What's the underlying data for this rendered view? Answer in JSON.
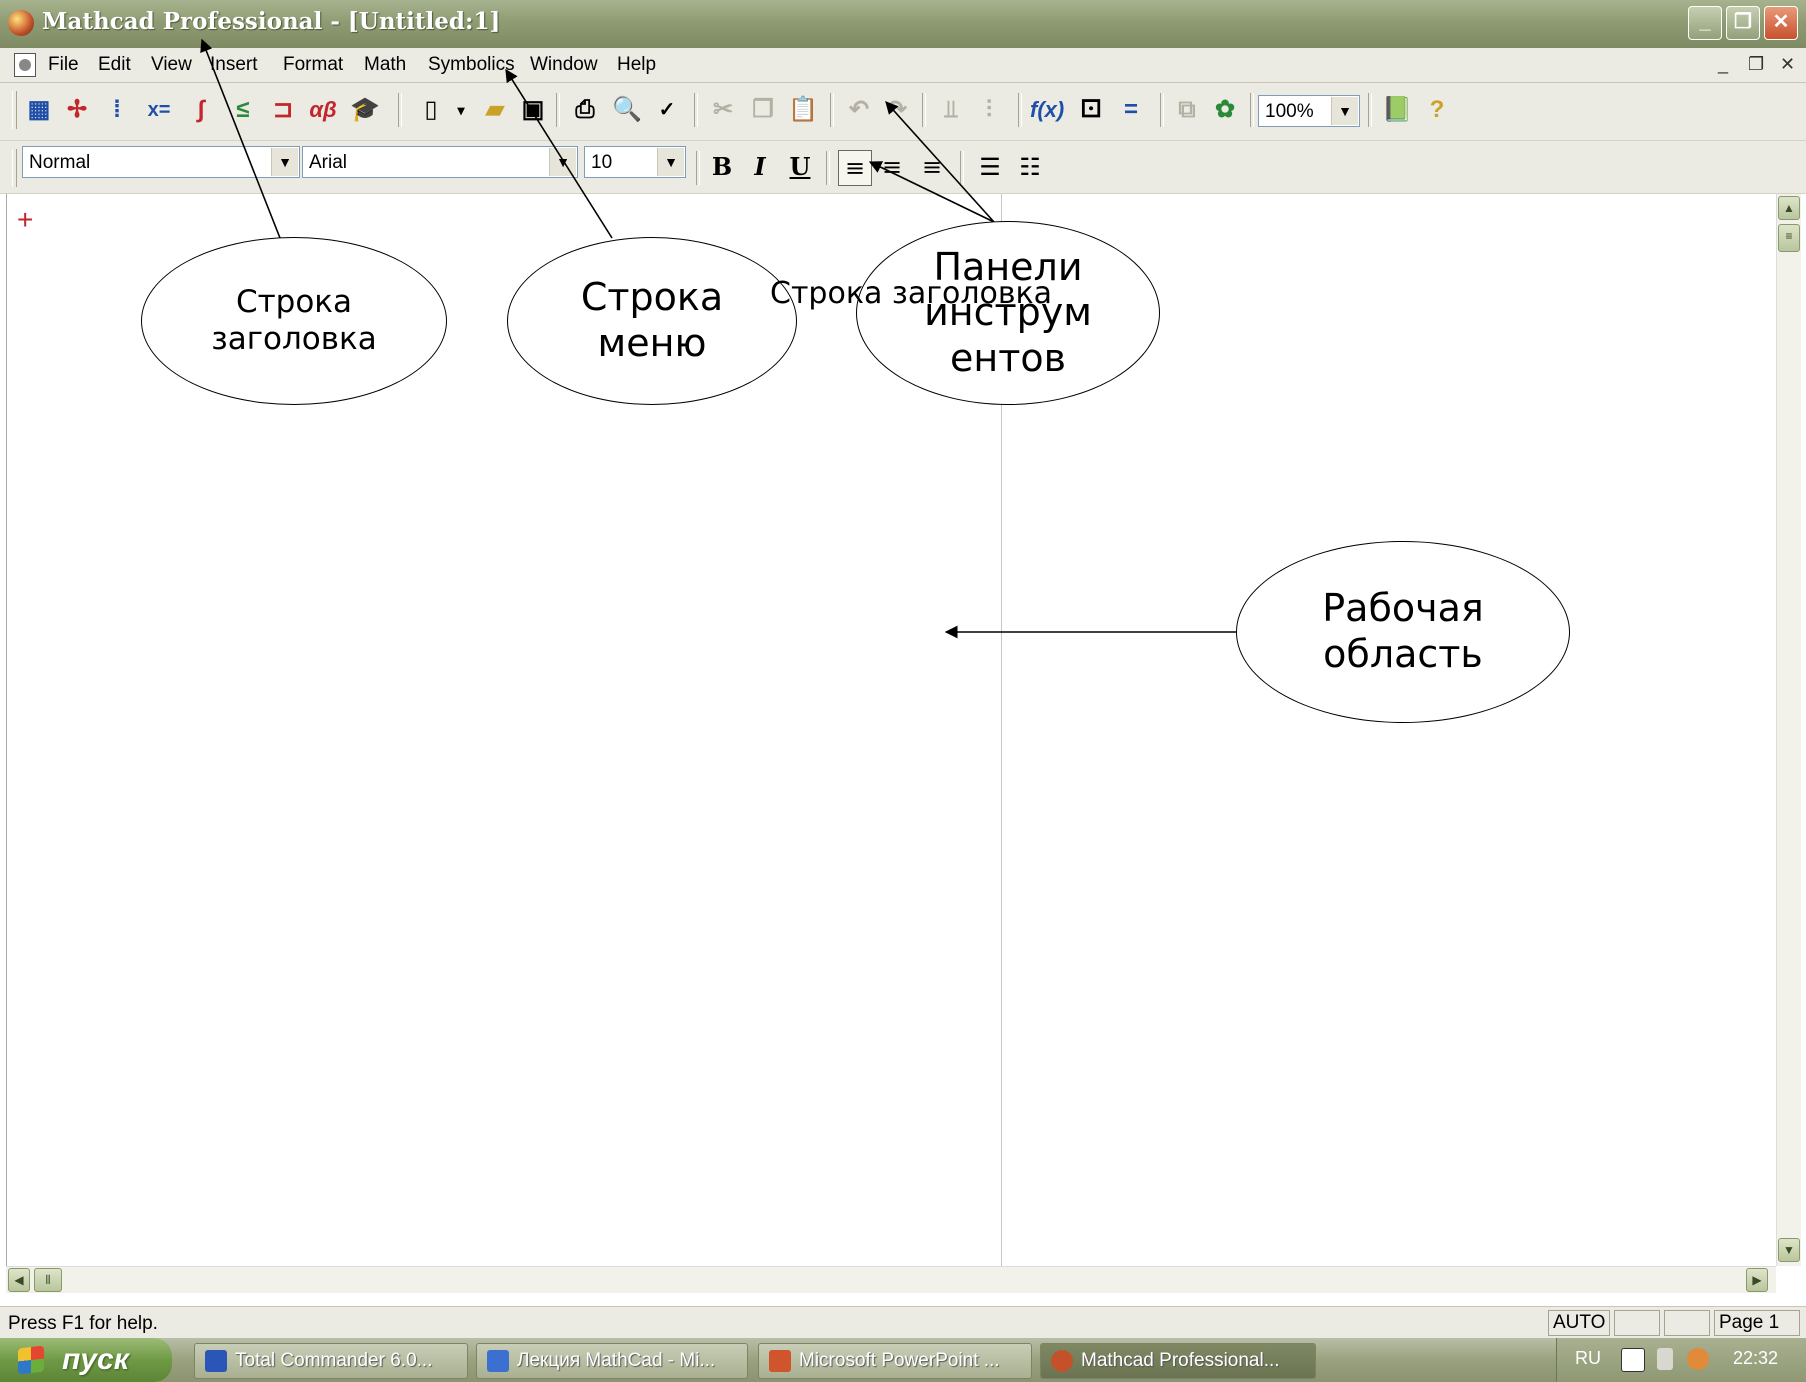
{
  "window": {
    "title": "Mathcad Professional - [Untitled:1]",
    "controls": {
      "minimize": "_",
      "restore": "❐",
      "close": "✕"
    }
  },
  "menubar": {
    "items": [
      "File",
      "Edit",
      "View",
      "Insert",
      "Format",
      "Math",
      "Symbolics",
      "Window",
      "Help"
    ],
    "mdi": {
      "minimize": "_",
      "restore": "❐",
      "close": "✕"
    }
  },
  "toolbar_standard": {
    "zoom": "100%"
  },
  "toolbar_formatting": {
    "style": "Normal",
    "font": "Arial",
    "size": "10",
    "bold": "B",
    "italic": "I",
    "underline": "U"
  },
  "workspace": {
    "cursor": "+"
  },
  "statusbar": {
    "help": "Press F1 for help.",
    "mode": "AUTO",
    "page": "Page 1"
  },
  "taskbar": {
    "start": "пуск",
    "tasks": [
      {
        "label": "Total Commander 6.0...",
        "color": "#2b56b8"
      },
      {
        "label": "Лекция MathCad - Mi...",
        "color": "#3b6fd0"
      },
      {
        "label": "Microsoft PowerPoint ...",
        "color": "#d0542c"
      },
      {
        "label": "Mathcad Professional...",
        "color": "#c4512a"
      }
    ],
    "tray": {
      "lang": "RU",
      "time": "22:32"
    }
  },
  "annotations": {
    "title_bar": "Строка\nзаголовка",
    "menu_bar": "Строка\nменю",
    "toolbars": "Панели\nинструм\nентов",
    "overlap_text": "Строка заголовка",
    "workspace": "Рабочая\nобласть"
  },
  "colors": {
    "titlebar": "#8f9c73",
    "chrome": "#ecebe3",
    "cursor": "#c1272d",
    "taskbar": "#9aa17f",
    "start_button": "#6f9a45"
  }
}
